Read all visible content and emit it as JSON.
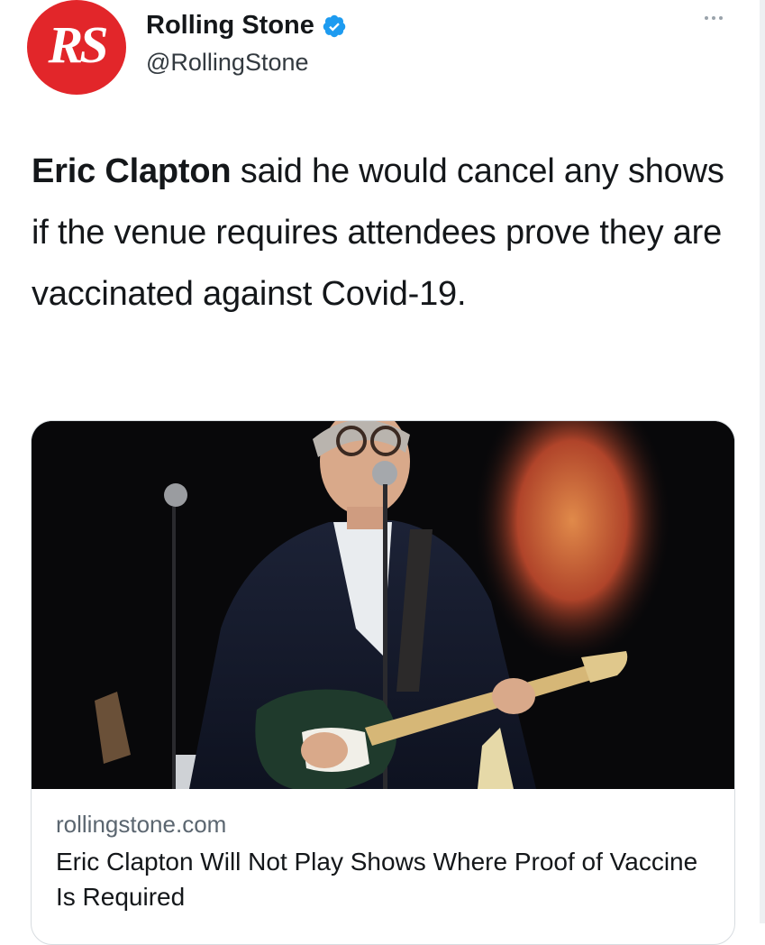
{
  "author": {
    "display_name": "Rolling Stone",
    "handle": "@RollingStone",
    "avatar_logo": "RS",
    "verified": true,
    "avatar_color": "#e2262a",
    "verified_color": "#1d9bf0"
  },
  "tweet": {
    "text_bold": "Eric Clapton",
    "text_rest": " said he would cancel any shows if the venue requires attendees prove they are vaccinated against Covid-19."
  },
  "link_card": {
    "domain": "rollingstone.com",
    "title": "Eric Clapton Will Not Play Shows Where Proof of Vaccine Is Required",
    "image_description_icon": "photo"
  },
  "icons": {
    "more": "more-horizontal-icon",
    "verified": "verified-badge-icon"
  }
}
